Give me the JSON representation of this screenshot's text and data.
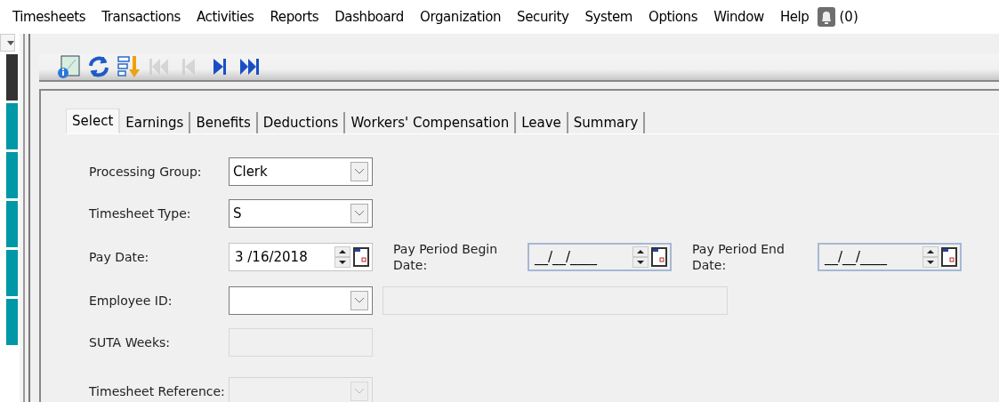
{
  "menu": [
    {
      "label": "Timesheets"
    },
    {
      "label": "Transactions"
    },
    {
      "label": "Activities"
    },
    {
      "label": "Reports"
    },
    {
      "label": "Dashboard"
    },
    {
      "label": "Organization"
    },
    {
      "label": "Security"
    },
    {
      "label": "System"
    },
    {
      "label": "Options"
    },
    {
      "label": "Window"
    },
    {
      "label": "Help"
    }
  ],
  "notifications": {
    "count": "(0)"
  },
  "toolbar": [
    {
      "kind": "info",
      "disabled": false
    },
    {
      "kind": "refresh",
      "disabled": false
    },
    {
      "kind": "sort",
      "disabled": false
    },
    {
      "kind": "first",
      "disabled": true
    },
    {
      "kind": "previous",
      "disabled": true
    },
    {
      "kind": "next",
      "disabled": false
    },
    {
      "kind": "last",
      "disabled": false
    }
  ],
  "tabs": [
    {
      "label": "Select",
      "selected": true
    },
    {
      "label": "Earnings",
      "selected": false
    },
    {
      "label": "Benefits",
      "selected": false
    },
    {
      "label": "Deductions",
      "selected": false
    },
    {
      "label": "Workers' Compensation",
      "selected": false
    },
    {
      "label": "Leave",
      "selected": false
    },
    {
      "label": "Summary",
      "selected": false
    }
  ],
  "form": {
    "processing_group": {
      "label": "Processing Group:",
      "value": "Clerk",
      "disabled": false
    },
    "timesheet_type": {
      "label": "Timesheet Type:",
      "value": "S",
      "disabled": false
    },
    "pay_date": {
      "label": "Pay Date:",
      "value": "3 /16/2018"
    },
    "pay_period_begin": {
      "label": "Pay Period Begin Date:",
      "value": "__/__/____"
    },
    "pay_period_end": {
      "label": "Pay Period End Date:",
      "value": "__/__/____"
    },
    "employee_id": {
      "label": "Employee ID:",
      "disabled": false
    },
    "employee_name": {
      "disabled": true
    },
    "suta_weeks": {
      "label": "SUTA Weeks:",
      "disabled": true
    },
    "timesheet_reference": {
      "label": "Timesheet Reference:",
      "disabled": true
    }
  }
}
